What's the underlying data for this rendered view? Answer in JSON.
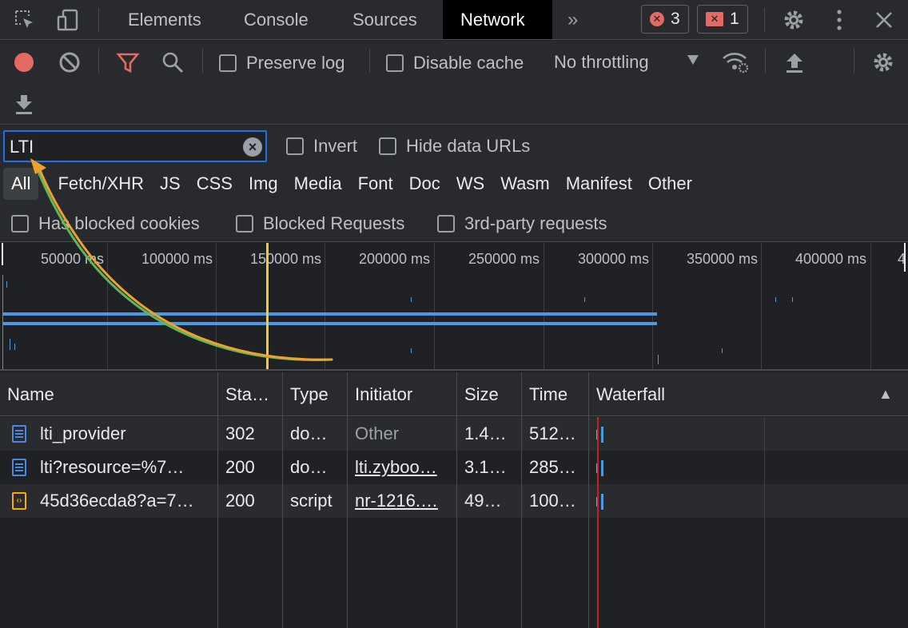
{
  "tabs": {
    "items": [
      "Elements",
      "Console",
      "Sources",
      "Network"
    ],
    "active": "Network",
    "more": "»",
    "error_count": "3",
    "issue_count": "1"
  },
  "toolbar": {
    "preserve_log": "Preserve log",
    "disable_cache": "Disable cache",
    "throttling": "No throttling"
  },
  "filter": {
    "value": "LTI",
    "invert": "Invert",
    "hide_data_urls": "Hide data URLs",
    "types": [
      "All",
      "Fetch/XHR",
      "JS",
      "CSS",
      "Img",
      "Media",
      "Font",
      "Doc",
      "WS",
      "Wasm",
      "Manifest",
      "Other"
    ],
    "selected_type": "All",
    "has_blocked_cookies": "Has blocked cookies",
    "blocked_requests": "Blocked Requests",
    "third_party": "3rd-party requests"
  },
  "overview": {
    "ticks": [
      "50000 ms",
      "100000 ms",
      "150000 ms",
      "200000 ms",
      "250000 ms",
      "300000 ms",
      "350000 ms",
      "400000 ms",
      "4"
    ]
  },
  "table": {
    "headers": [
      "Name",
      "Sta…",
      "Type",
      "Initiator",
      "Size",
      "Time",
      "Waterfall"
    ],
    "sort_indicator": "▲",
    "rows": [
      {
        "name": "lti_provider",
        "status": "302",
        "type": "do…",
        "initiator": "Other",
        "size": "1.4…",
        "time": "512…",
        "icon": "document-icon"
      },
      {
        "name": "lti?resource=%7…",
        "status": "200",
        "type": "do…",
        "initiator": "lti.zyboo…",
        "size": "3.1…",
        "time": "285…",
        "icon": "document-icon"
      },
      {
        "name": "45d36ecda8?a=7…",
        "status": "200",
        "type": "script",
        "initiator": "nr-1216.…",
        "size": "49…",
        "time": "100…",
        "icon": "script-icon"
      }
    ]
  },
  "colors": {
    "accent": "#1a73e8",
    "record": "#e46962",
    "filter_icon": "#e46962",
    "timeline_bar": "#4b98e4",
    "dcl_line": "#f9c642",
    "load_line": "#c5221f",
    "arrow": "#f0a12b"
  }
}
